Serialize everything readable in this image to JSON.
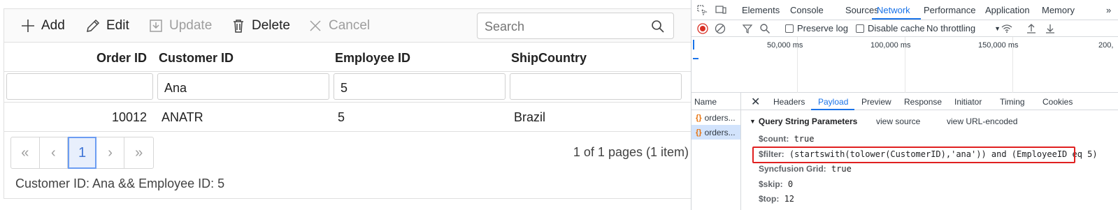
{
  "toolbar": {
    "add": "Add",
    "edit": "Edit",
    "update": "Update",
    "delete": "Delete",
    "cancel": "Cancel",
    "search_placeholder": "Search"
  },
  "columns": [
    "Order ID",
    "Customer ID",
    "Employee ID",
    "ShipCountry"
  ],
  "filters": {
    "order_id": "",
    "customer_id": "Ana",
    "employee_id": "5",
    "ship_country": ""
  },
  "rows": [
    {
      "order_id": "10012",
      "customer_id": "ANATR",
      "employee_id": "5",
      "ship_country": "Brazil"
    }
  ],
  "pager": {
    "first": "«",
    "prev": "‹",
    "current": "1",
    "next": "›",
    "last": "»",
    "info": "1 of 1 pages (1 item)"
  },
  "status_message": "Customer ID: Ana && Employee ID: 5",
  "devtools": {
    "tabs": [
      "Elements",
      "Console",
      "Sources",
      "Network",
      "Performance",
      "Application",
      "Memory"
    ],
    "active_tab": "Network",
    "more": "»",
    "toolbar": {
      "preserve_log": "Preserve log",
      "disable_cache": "Disable cache",
      "throttling": "No throttling"
    },
    "timeline_labels": [
      "50,000 ms",
      "100,000 ms",
      "150,000 ms",
      "200,"
    ],
    "name_header": "Name",
    "requests": [
      "orders...",
      "orders..."
    ],
    "detail_tabs": [
      "Headers",
      "Payload",
      "Preview",
      "Response",
      "Initiator",
      "Timing",
      "Cookies"
    ],
    "active_detail_tab": "Payload",
    "query_string_title": "Query String Parameters",
    "view_source": "view source",
    "view_url_encoded": "view URL-encoded",
    "params": [
      {
        "key": "$count:",
        "value": "true"
      },
      {
        "key": "$filter:",
        "value": "(startswith(tolower(CustomerID),'ana')) and (EmployeeID eq 5)"
      },
      {
        "key": "Syncfusion Grid:",
        "value": "true"
      },
      {
        "key": "$skip:",
        "value": "0"
      },
      {
        "key": "$top:",
        "value": "12"
      }
    ],
    "highlight_color": "#e02020",
    "accent_color": "#1a73e8"
  }
}
